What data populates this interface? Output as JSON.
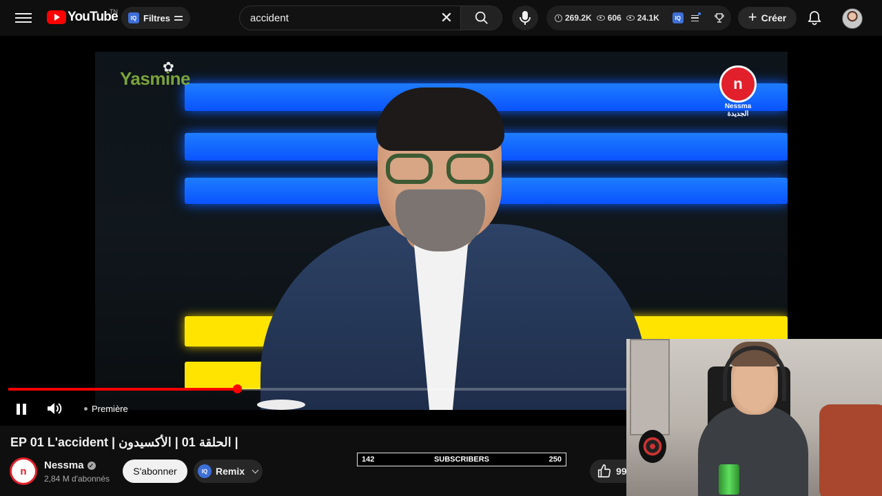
{
  "header": {
    "logo_text": "YouTube",
    "region": "TN",
    "filters_label": "Filtres",
    "iq_label": "IQ",
    "search_value": "accident",
    "stats": {
      "time": "269.2K",
      "views_a": "606",
      "views_b": "24.1K"
    },
    "create_label": "Créer"
  },
  "player": {
    "progress_fraction": 0.37,
    "status_label": "Première",
    "overlay_left_logo": "Yasmine",
    "overlay_right_logo_text": "Nessma الجديدة"
  },
  "video": {
    "title": "EP 01 L'accident | الحلقة 01 | الأكسيدون |",
    "channel": {
      "name": "Nessma",
      "subscribers": "2,84 M d'abonnés"
    },
    "subscribe_label": "S'abonner",
    "remix_label": "Remix",
    "like_count": "99"
  },
  "sub_goal": {
    "current": "142",
    "label": "SUBSCRIBERS",
    "target": "250"
  },
  "colors": {
    "accent": "#ff0000",
    "background": "#0f0f0f",
    "nessma_red": "#e2202b"
  }
}
